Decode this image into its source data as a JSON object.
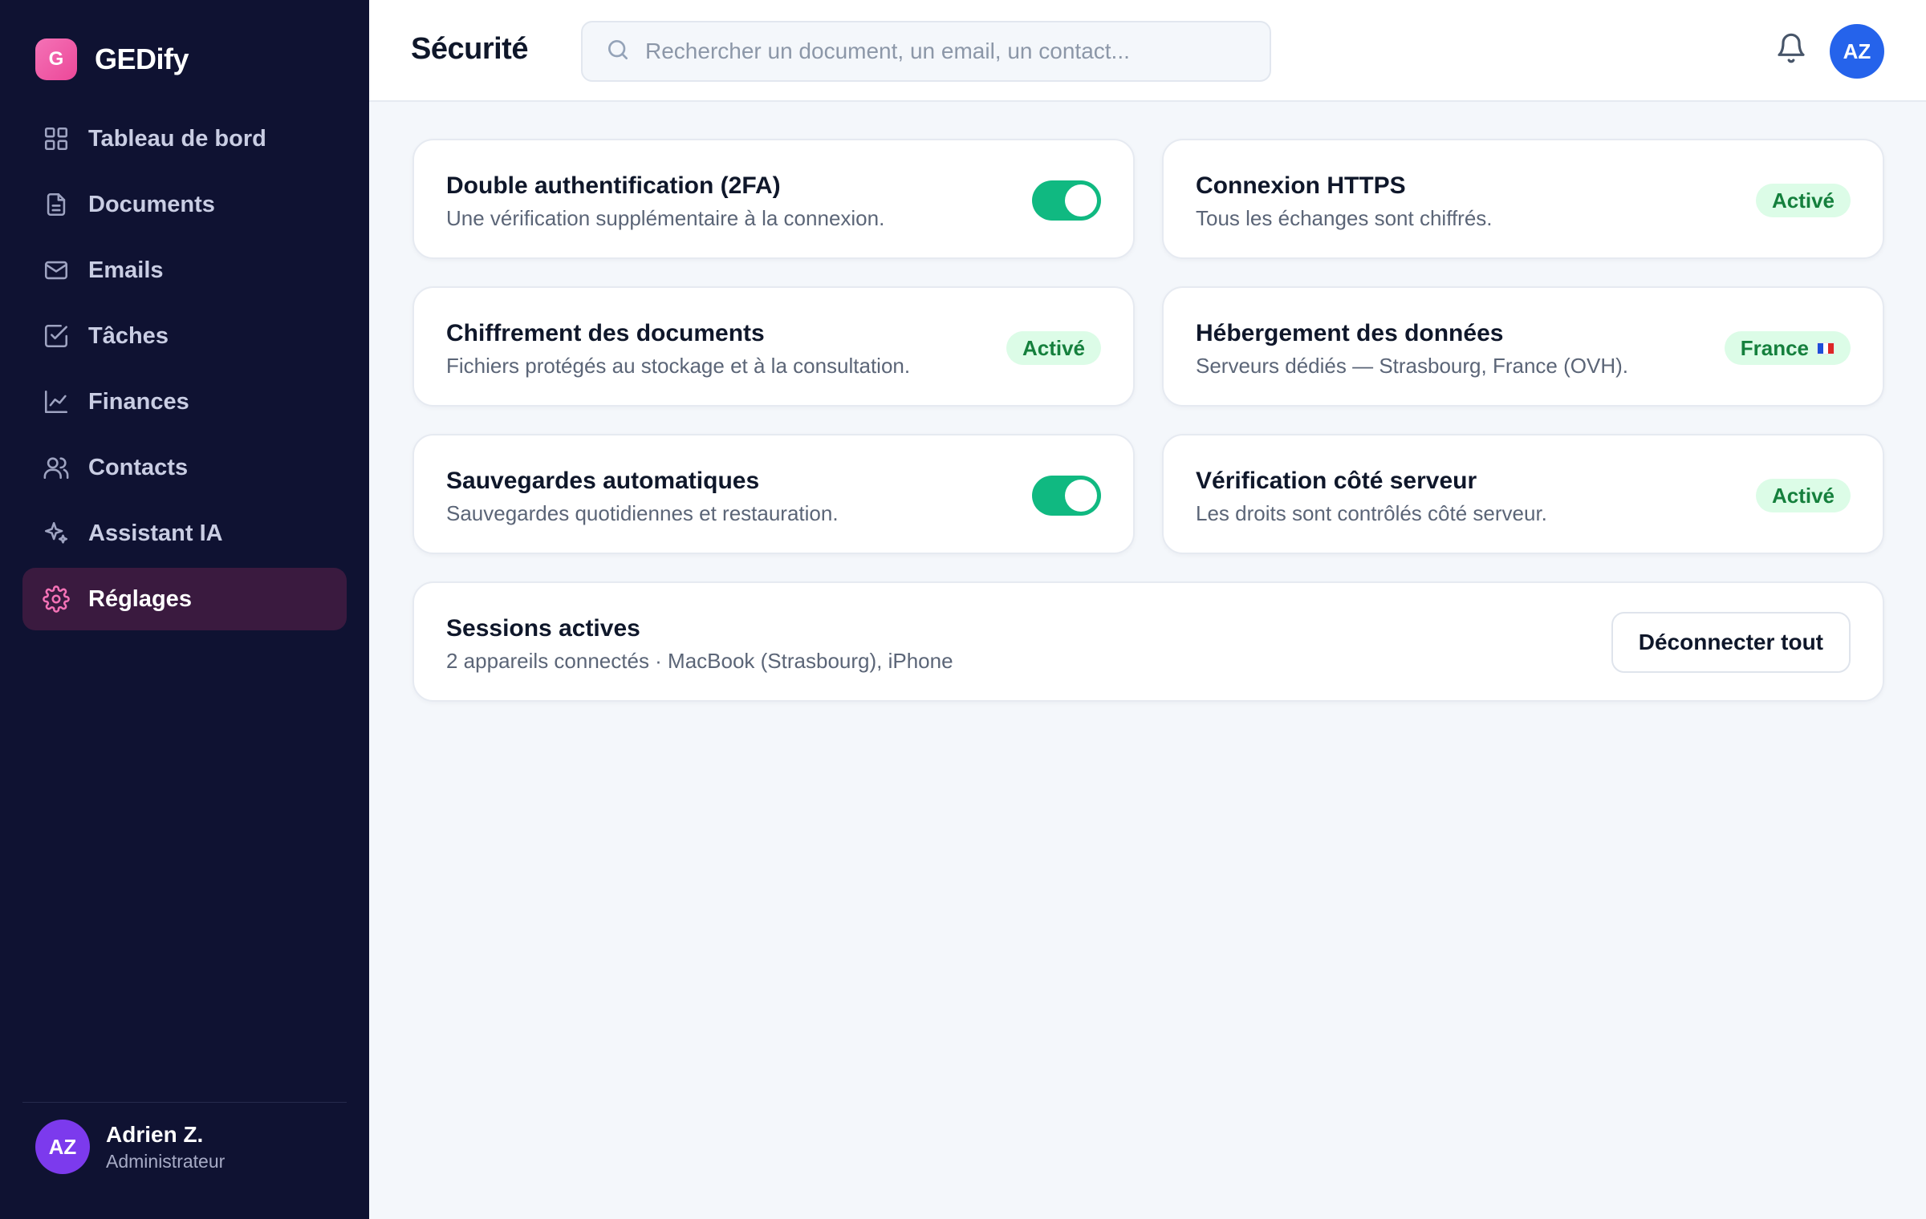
{
  "app": {
    "logo_letter": "G",
    "name": "GEDify"
  },
  "sidebar": {
    "items": [
      {
        "label": "Tableau de bord",
        "icon": "dashboard-icon"
      },
      {
        "label": "Documents",
        "icon": "document-icon"
      },
      {
        "label": "Emails",
        "icon": "mail-icon"
      },
      {
        "label": "Tâches",
        "icon": "checkbox-icon"
      },
      {
        "label": "Finances",
        "icon": "chart-icon"
      },
      {
        "label": "Contacts",
        "icon": "users-icon"
      },
      {
        "label": "Assistant IA",
        "icon": "sparkles-icon"
      },
      {
        "label": "Réglages",
        "icon": "gear-icon",
        "active": true
      }
    ],
    "user": {
      "initials": "AZ",
      "name": "Adrien Z.",
      "role": "Administrateur"
    }
  },
  "header": {
    "title": "Sécurité",
    "search_placeholder": "Rechercher un document, un email, un contact...",
    "avatar_initials": "AZ"
  },
  "cards": {
    "two_factor": {
      "title": "Double authentification (2FA)",
      "desc": "Une vérification supplémentaire à la connexion.",
      "enabled": true
    },
    "https": {
      "title": "Connexion HTTPS",
      "desc": "Tous les échanges sont chiffrés.",
      "badge": "Activé"
    },
    "encryption": {
      "title": "Chiffrement des documents",
      "desc": "Fichiers protégés au stockage et à la consultation.",
      "badge": "Activé"
    },
    "hosting": {
      "title": "Hébergement des données",
      "desc": "Serveurs dédiés — Strasbourg, France (OVH).",
      "badge": "France"
    },
    "backups": {
      "title": "Sauvegardes automatiques",
      "desc": "Sauvegardes quotidiennes et restauration.",
      "enabled": true
    },
    "server_check": {
      "title": "Vérification côté serveur",
      "desc": "Les droits sont contrôlés côté serveur.",
      "badge": "Activé"
    },
    "sessions": {
      "title": "Sessions actives",
      "desc": "2 appareils connectés · MacBook (Strasbourg), iPhone",
      "button": "Déconnecter tout"
    }
  },
  "colors": {
    "sidebar_bg": "#0f1232",
    "accent_pink": "#ec4899",
    "toggle_on": "#10b981",
    "badge_bg": "#dcfce7",
    "badge_text": "#15803d",
    "avatar_blue": "#2563eb",
    "avatar_purple": "#7c3aed"
  }
}
